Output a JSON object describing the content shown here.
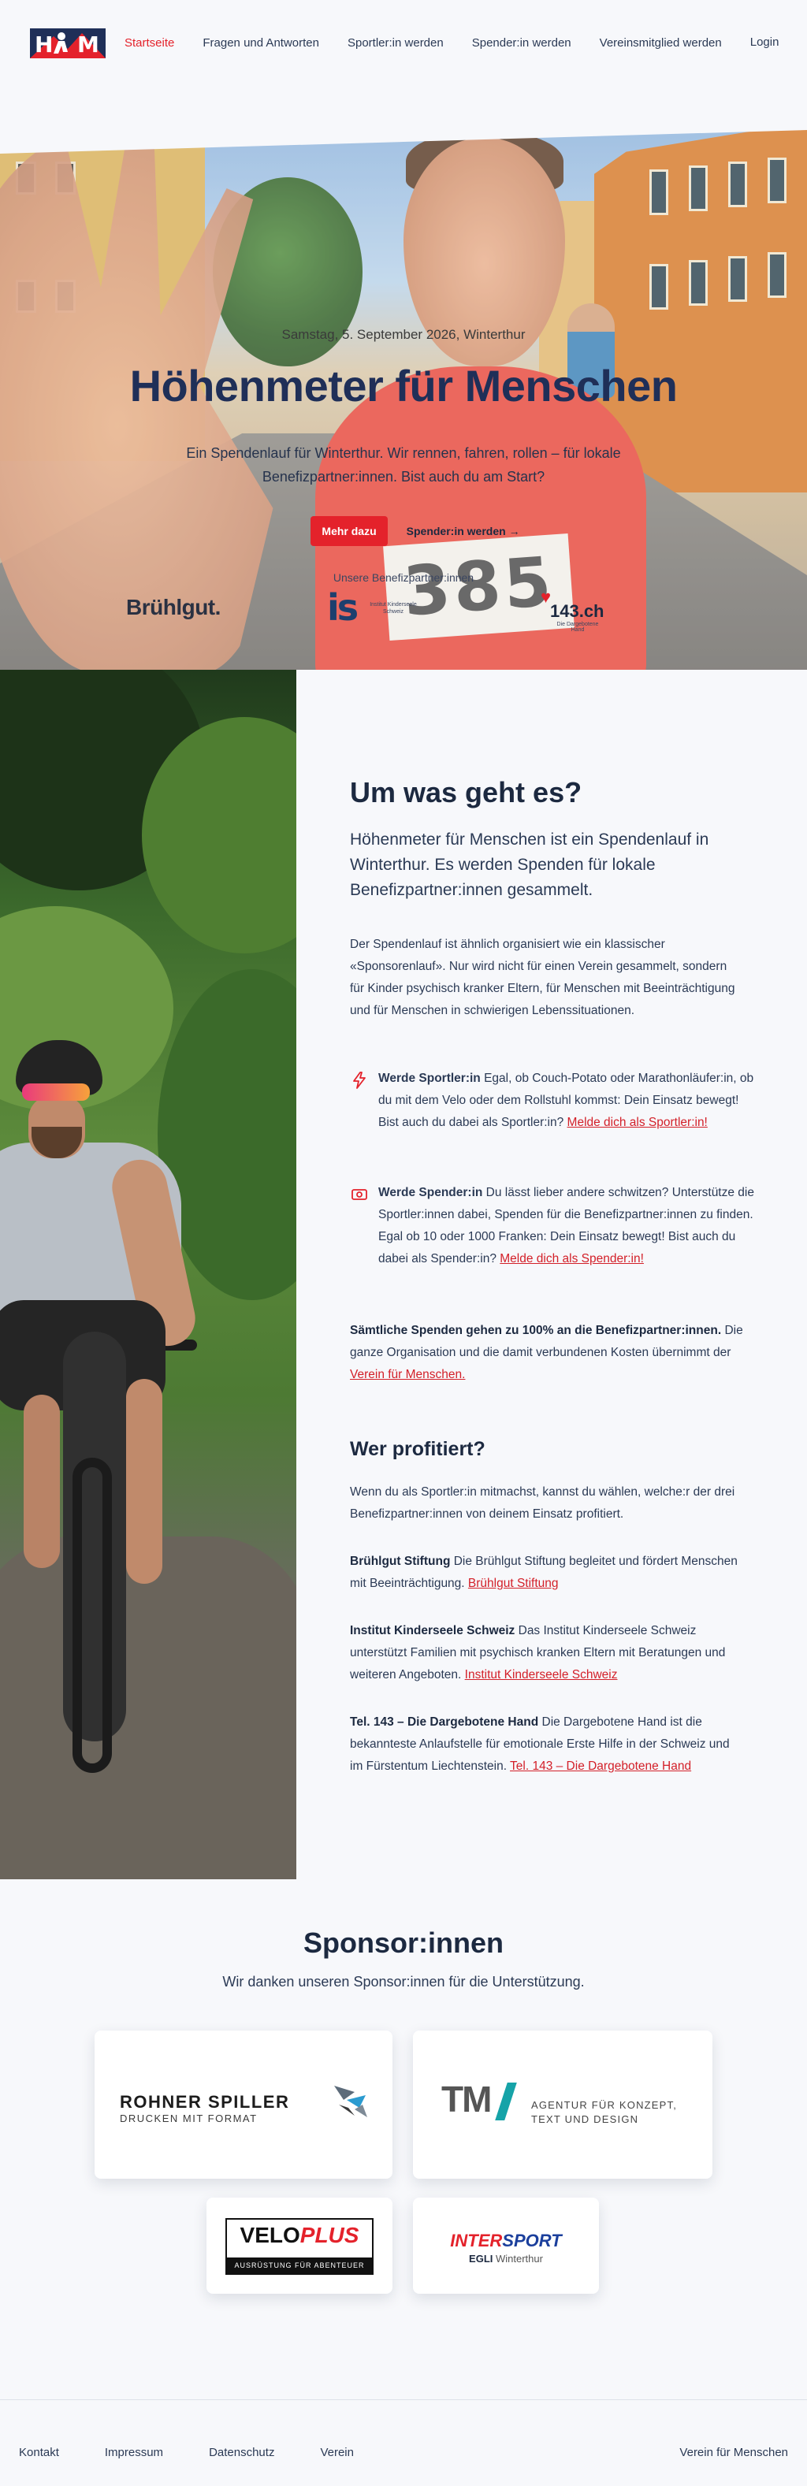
{
  "nav": {
    "logo_alt": "HfM",
    "links": [
      "Startseite",
      "Fragen und Antworten",
      "Sportler:in werden",
      "Spender:in werden",
      "Vereinsmitglied werden"
    ],
    "login": "Login"
  },
  "hero": {
    "date": "Samstag, 5. September 2026, Winterthur",
    "title": "Höhenmeter für Menschen",
    "subtitle": "Ein Spendenlauf für Winterthur. Wir rennen, fahren, rollen – für lokale Benefizpartner:innen. Bist auch du am Start?",
    "cta_primary": "Mehr dazu",
    "cta_secondary": "Spender:in werden →",
    "bib_number": "385",
    "partners_label": "Unsere Benefizpartner:innen",
    "partners": {
      "bruhlgut": "Brühlgut.",
      "is_mark": "is",
      "is_text": "Institut Kinderseele Schweiz",
      "tel143": "143.ch",
      "tel143_small": "Die Dargebotene Hand"
    }
  },
  "about": {
    "title": "Um was geht es?",
    "lead": "Höhenmeter für Menschen ist ein Spendenlauf in Winterthur. Es werden Spenden für lokale Benefizpartner:innen gesammelt.",
    "para1": "Der Spendenlauf ist ähnlich organisiert wie ein klassischer «Sponsorenlauf». Nur wird nicht für einen Verein gesammelt, sondern für Kinder psychisch kranker Eltern, für Menschen mit Beeinträchtigung und für Menschen in schwierigen Lebenssituationen.",
    "feature_sportler": {
      "title": "Werde Sportler:in",
      "text": " Egal, ob Couch-Potato oder Marathonläufer:in, ob du mit dem Velo oder dem Rollstuhl kommst: Dein Einsatz bewegt! Bist auch du dabei als Sportler:in? ",
      "link": "Melde dich als Sportler:in!"
    },
    "feature_spender": {
      "title": "Werde Spender:in",
      "text": " Du lässt lieber andere schwitzen? Unterstütze die Sportler:innen dabei, Spenden für die Benefizpartner:innen zu finden. Egal ob 10 oder 1000 Franken: Dein Einsatz bewegt! Bist auch du dabei als Spender:in? ",
      "link": "Melde dich als Spender:in!"
    },
    "donation_bold": "Sämtliche Spenden gehen zu 100% an die Benefizpartner:innen.",
    "donation_text": " Die ganze Organisation und die damit verbundenen Kosten übernimmt der ",
    "donation_link": "Verein für Menschen.",
    "profit_title": "Wer profitiert?",
    "profit_intro": "Wenn du als Sportler:in mitmachst, kannst du wählen, welche:r der drei Benefizpartner:innen von deinem Einsatz profitiert.",
    "partners": [
      {
        "name": "Brühlgut Stiftung",
        "text": " Die Brühlgut Stiftung begleitet und fördert Menschen mit Beeinträchtigung. ",
        "link": "Brühlgut Stiftung"
      },
      {
        "name": "Institut Kinderseele Schweiz",
        "text": " Das Institut Kinderseele Schweiz unterstützt Familien mit psychisch kranken Eltern mit Beratungen und weiteren Angeboten. ",
        "link": "Institut Kinderseele Schweiz"
      },
      {
        "name": "Tel. 143 – Die Dargebotene Hand",
        "text": " Die Dargebotene Hand ist die bekannteste Anlaufstelle für emotionale Erste Hilfe in der Schweiz und im Fürstentum Liechtenstein. ",
        "link": "Tel. 143 – Die Dargebotene Hand"
      }
    ]
  },
  "sponsors": {
    "title": "Sponsor:innen",
    "subtitle": "Wir danken unseren Sponsor:innen für die Unterstützung.",
    "rohner_name": "ROHNER SPILLER",
    "rohner_tag": "DRUCKEN MIT FORMAT",
    "tm_mark": "TM",
    "tm_text_1": "AGENTUR FÜR KONZEPT,",
    "tm_text_2": "TEXT UND DESIGN",
    "velo_a": "VELO",
    "velo_b": "PLUS",
    "velo_band": "AUSRÜSTUNG FÜR ABENTEUER",
    "inter_a": "INTER",
    "inter_b": "SPORT",
    "inter_sub_a": "EGLI",
    "inter_sub_b": " Winterthur"
  },
  "footer": {
    "links": [
      "Kontakt",
      "Impressum",
      "Datenschutz",
      "Verein"
    ],
    "right": "Verein für Menschen"
  },
  "colors": {
    "accent": "#e4222b",
    "navy": "#1c2940",
    "background": "#f7f8fb"
  }
}
